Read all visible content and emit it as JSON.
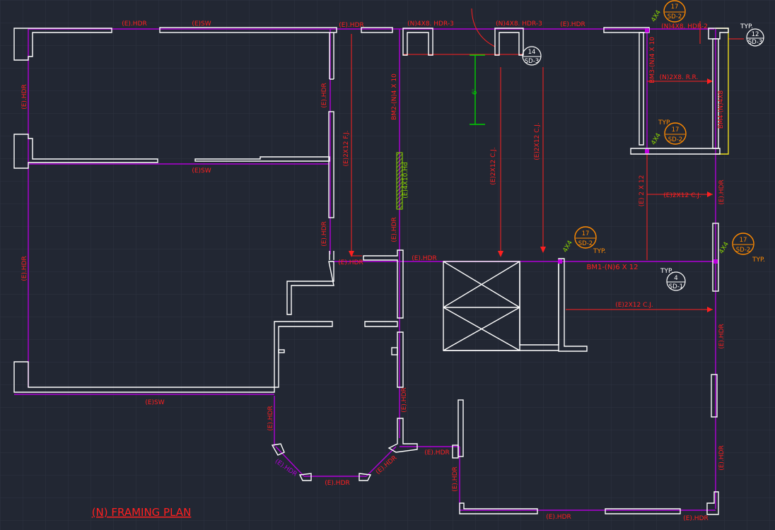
{
  "plan_title": "(N) FRAMING PLAN",
  "colors": {
    "background": "#222733",
    "grid": "#2d3341",
    "wall": "#ffffff",
    "beam_line": "#b000d8",
    "label_red": "#ff2020",
    "callout_orange": "#ff8a00",
    "post_green": "#8bd400",
    "dim_green": "#00d000",
    "yellow": "#f0e020"
  },
  "labels": {
    "hdr_top_left": "(E).HDR",
    "sw_top": "(E)SW",
    "hdr_top_mid": "(E).HDR",
    "n4x8_hdr3_a": "(N)4X8. HDR-3",
    "n4x8_hdr3_b": "(N)4X8. HDR-3",
    "hdr_top_right": "(E).HDR",
    "n4x8_hdr2": "(N)4X8. HDR-2",
    "hdr_left_vert": "(E).HDR",
    "hdr_left_lower": "(E).HDR",
    "sw_mid": "(E)SW",
    "hdr_inner_upper": "(E).HDR",
    "hdr_inner_lower": "(E).HDR",
    "fj": "(E)2X12 F.J.",
    "bm2": "BM2-(N)4 X 10",
    "post_4x10": "(E)4X10.Hd",
    "cj_a": "(E)2X12 C.J.",
    "cj_b": "(E)2X12 C.J.",
    "hdr_center_vert": "(E).HDR",
    "hdr_entry": "(E).HDR",
    "hdr_small": "(E).HDR",
    "bm3": "BM3-(N)4 X 10",
    "rr": "(N)2X8. R.R.",
    "bm4": "BM4-(N)4X8",
    "e2x12": "(E) 2 X 12",
    "cj_right": "(E)2X12 C.J.",
    "bm1": "BM1-(N)6 X 12",
    "cj_lower": "(E)2X12 C.J.",
    "hdr_right_a": "(E).HDR",
    "hdr_right_b": "(E).HDR",
    "hdr_right_c": "(E).HDR",
    "sw_bottom": "(E)SW",
    "hdr_bay_left": "(E).HDR",
    "hdr_bay_diag_left": "(E).HDR",
    "hdr_bay_bottom": "(E).HDR",
    "hdr_bay_diag_right": "(E).HDR",
    "hdr_bay_right": "(E).HDR",
    "hdr_closet": "(E).HDR",
    "hdr_closet_vert": "(E).HDR",
    "hdr_bottom": "(E).HDR",
    "hdr_bottom_right": "(E).HDR",
    "dim_6": "6'",
    "typ_a": "TYP.",
    "typ_b": "TYP.",
    "typ_c": "TYP.",
    "typ_d": "TYP.",
    "typ_e": "TYP.",
    "post_4x4_a": "4X4",
    "post_4x4_b": "4X4",
    "post_4x4_c": "4X4",
    "post_4x4_d": "4X4"
  },
  "callouts": [
    {
      "num": "17",
      "ref": "SD-2",
      "color": "orange"
    },
    {
      "num": "17",
      "ref": "SD-2",
      "color": "orange"
    },
    {
      "num": "17",
      "ref": "SD-2",
      "color": "orange"
    },
    {
      "num": "17",
      "ref": "SD-2",
      "color": "orange"
    },
    {
      "num": "14",
      "ref": "SD-3",
      "color": "white"
    },
    {
      "num": "12",
      "ref": "SD-3",
      "color": "white"
    },
    {
      "num": "4",
      "ref": "SD-1",
      "color": "white"
    }
  ]
}
